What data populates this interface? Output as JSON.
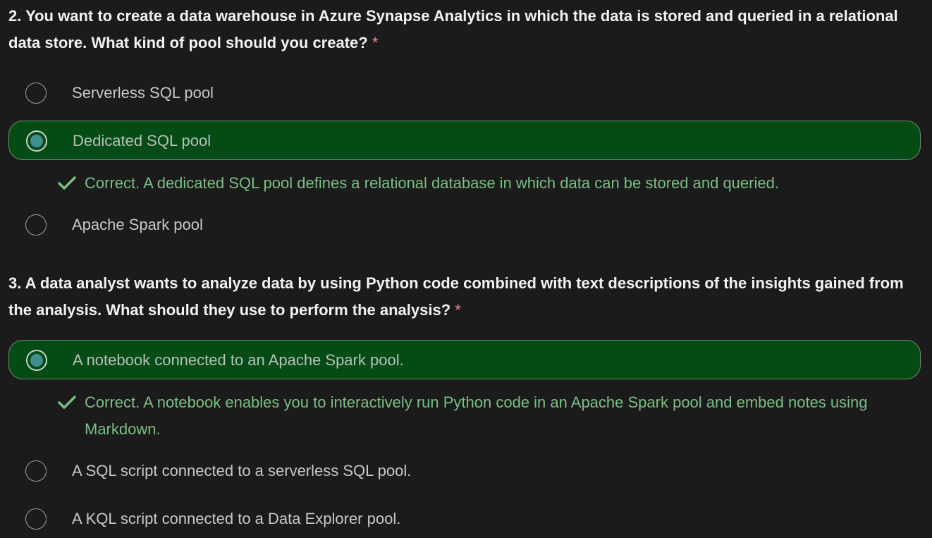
{
  "questions": [
    {
      "text": "2. You want to create a data warehouse in Azure Synapse Analytics in which the data is stored and queried in a relational data store. What kind of pool should you create?",
      "required_mark": "*",
      "options": [
        {
          "label": "Serverless SQL pool",
          "selected": false
        },
        {
          "label": "Dedicated SQL pool",
          "selected": true
        },
        {
          "label": "Apache Spark pool",
          "selected": false
        }
      ],
      "feedback": {
        "icon": "checkmark-icon",
        "text": "Correct. A dedicated SQL pool defines a relational database in which data can be stored and queried."
      }
    },
    {
      "text": "3. A data analyst wants to analyze data by using Python code combined with text descriptions of the insights gained from the analysis. What should they use to perform the analysis?",
      "required_mark": "*",
      "options": [
        {
          "label": "A notebook connected to an Apache Spark pool.",
          "selected": true
        },
        {
          "label": "A SQL script connected to a serverless SQL pool.",
          "selected": false
        },
        {
          "label": "A KQL script connected to a Data Explorer pool.",
          "selected": false
        }
      ],
      "feedback": {
        "icon": "checkmark-icon",
        "text": "Correct. A notebook enables you to interactively run Python code in an Apache Spark pool and embed notes using Markdown."
      }
    }
  ],
  "colors": {
    "background": "#1b1b1b",
    "selected_background": "#054b16",
    "correct_text": "#79bf82",
    "radio_fill": "#3f8f8f"
  }
}
